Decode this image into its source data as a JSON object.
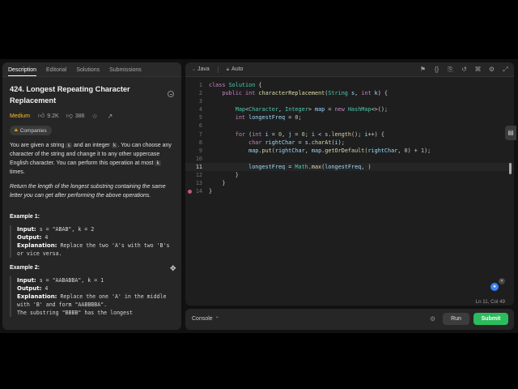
{
  "left_tabs": [
    "Description",
    "Editorial",
    "Solutions",
    "Submissions"
  ],
  "problem": {
    "title": "424. Longest Repeating Character Replacement",
    "difficulty": "Medium",
    "likes": "9.2K",
    "dislikes": "386",
    "companies_label": "Companies",
    "para1_a": "You are given a string ",
    "para1_s": "s",
    "para1_b": " and an integer ",
    "para1_k": "k",
    "para1_c": ". You can choose any character of the string and change it to any other uppercase English character. You can perform this operation at most ",
    "para1_k2": "k",
    "para1_d": " times.",
    "para2": "Return the length of the longest substring containing the same letter you can get after performing the above operations.",
    "example1": {
      "title": "Example 1:",
      "input_label": "Input:",
      "input": " s = \"ABAB\", k = 2",
      "output_label": "Output:",
      "output": " 4",
      "expl_label": "Explanation:",
      "expl": " Replace the two 'A's with two 'B's or vice versa."
    },
    "example2": {
      "title": "Example 2:",
      "input_label": "Input:",
      "input": " s = \"AABABBA\", k = 1",
      "output_label": "Output:",
      "output": " 4",
      "expl_label": "Explanation:",
      "expl": " Replace the one 'A' in the middle with 'B' and form \"AABBBBA\".",
      "expl2": "The substring \"BBBB\" has the longest"
    }
  },
  "editor": {
    "language": "Java",
    "mode": "Auto",
    "status": "Ln 11, Col 49",
    "line_numbers": [
      "1",
      "2",
      "3",
      "4",
      "5",
      "6",
      "7",
      "8",
      "9",
      "10",
      "11",
      "12",
      "13",
      "14"
    ]
  },
  "console": {
    "label": "Console",
    "run_label": "Run",
    "submit_label": "Submit"
  },
  "colors": {
    "accent_submit": "#2cbb5d",
    "difficulty_medium": "#ffc01e"
  }
}
